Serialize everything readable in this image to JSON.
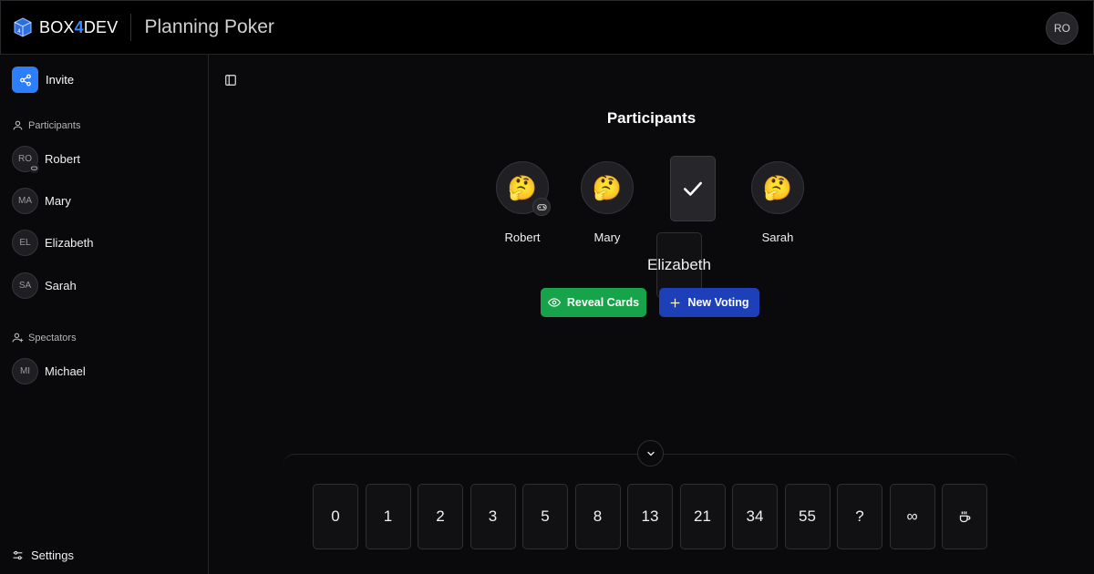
{
  "header": {
    "logo_prefix": "BOX",
    "logo_accent": "4",
    "logo_suffix": "DEV",
    "app_title": "Planning Poker",
    "user_initials": "RO"
  },
  "sidebar": {
    "invite_label": "Invite",
    "participants_heading": "Participants",
    "participants": [
      {
        "initials": "RO",
        "name": "Robert"
      },
      {
        "initials": "MA",
        "name": "Mary"
      },
      {
        "initials": "EL",
        "name": "Elizabeth"
      },
      {
        "initials": "SA",
        "name": "Sarah"
      }
    ],
    "spectators_heading": "Spectators",
    "spectators": [
      {
        "initials": "MI",
        "name": "Michael"
      }
    ],
    "settings_label": "Settings"
  },
  "main": {
    "heading": "Participants",
    "players": [
      {
        "name": "Robert",
        "state": "thinking",
        "emoji": "🤔",
        "is_moderator": true
      },
      {
        "name": "Mary",
        "state": "thinking",
        "emoji": "🤔"
      },
      {
        "name": "Elizabeth",
        "state": "voted"
      },
      {
        "name": "Sarah",
        "state": "thinking",
        "emoji": "🤔"
      }
    ],
    "reveal_label": "Reveal Cards",
    "new_voting_label": "New Voting",
    "cards": [
      "0",
      "1",
      "2",
      "3",
      "5",
      "8",
      "13",
      "21",
      "34",
      "55",
      "?",
      "∞",
      "coffee"
    ]
  },
  "colors": {
    "accent_blue": "#2d7ff9",
    "reveal_green": "#16a34a",
    "new_voting_blue": "#1d3fb8"
  }
}
